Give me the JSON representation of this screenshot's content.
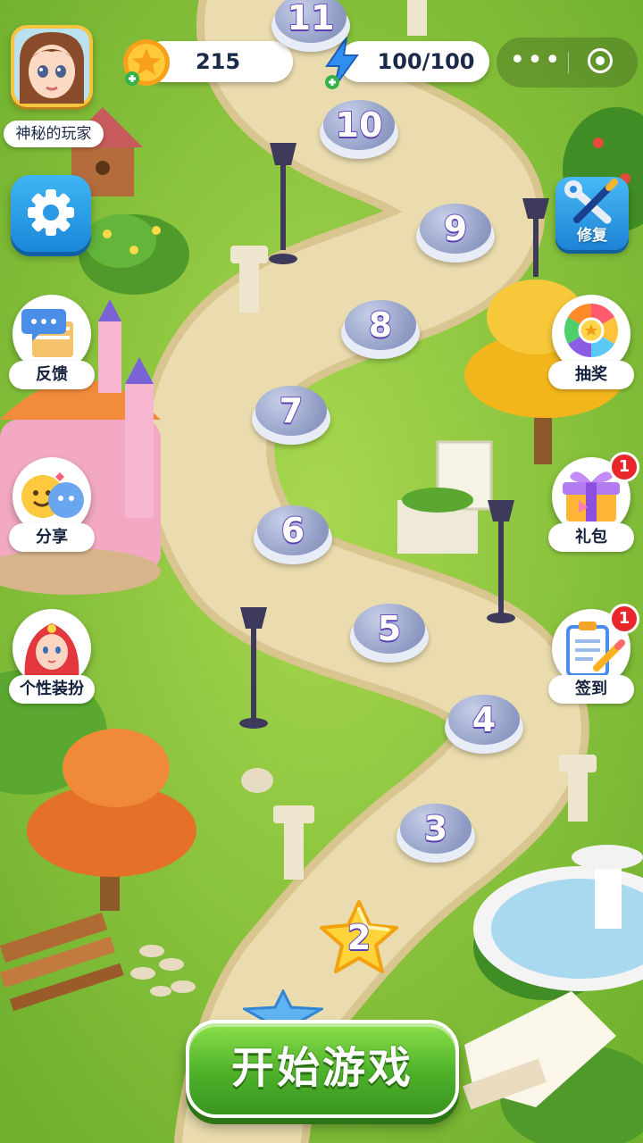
{
  "player": {
    "name": "神秘的玩家"
  },
  "currency": {
    "coins": "215",
    "energy": "100/100"
  },
  "side_menu_left": [
    {
      "label": "反馈"
    },
    {
      "label": "分享"
    },
    {
      "label": "个性装扮"
    }
  ],
  "side_menu_right": [
    {
      "label": "修复"
    },
    {
      "label": "抽奖"
    },
    {
      "label": "礼包",
      "badge": "1"
    },
    {
      "label": "签到",
      "badge": "1"
    }
  ],
  "levels": [
    "11",
    "10",
    "9",
    "8",
    "7",
    "6",
    "5",
    "4",
    "3",
    "2"
  ],
  "current_level": "2",
  "start_button": {
    "label": "开始游戏"
  },
  "colors": {
    "grass": "#8cc63f",
    "path": "#eadcae",
    "level_locked": "#8f9bc4",
    "level_current": "#ffd43b",
    "start_button": "#4eb12a",
    "badge": "#e8262b"
  }
}
